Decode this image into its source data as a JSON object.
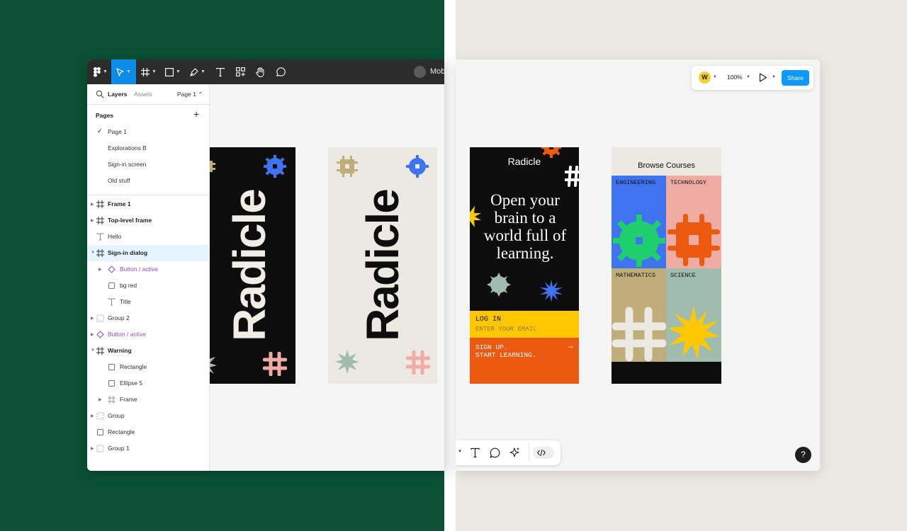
{
  "toolbar": {
    "file_name": "Mob"
  },
  "sidebar": {
    "tabs": {
      "layers": "Layers",
      "assets": "Assets"
    },
    "page_selector": "Page 1 ⌃",
    "pages_heading": "Pages",
    "pages_add": "+",
    "pages": [
      "Page 1",
      "Explorations B",
      "Sign-in screen",
      "Old stuff"
    ],
    "current_page_check": "✓",
    "layers": [
      {
        "label": "Frame 1"
      },
      {
        "label": "Top-level frame"
      },
      {
        "label": "Hello"
      },
      {
        "label": "Sign-in dialog"
      },
      {
        "label": "Button / active"
      },
      {
        "label": "bg red"
      },
      {
        "label": "Title"
      },
      {
        "label": "Group 2"
      },
      {
        "label": "Button / active"
      },
      {
        "label": "Warning"
      },
      {
        "label": "Rectangle"
      },
      {
        "label": "Ellipse 5"
      },
      {
        "label": "Frame"
      },
      {
        "label": "Group"
      },
      {
        "label": "Rectangle"
      },
      {
        "label": "Group 1"
      }
    ]
  },
  "topbar_right": {
    "avatar_initial": "W",
    "zoom": "100%",
    "share_label": "Share"
  },
  "help_label": "?",
  "frames": {
    "word": "Radicle",
    "signin": {
      "logo": "Radicle",
      "headline": "Open your brain to a world full of learning.",
      "login_label": "LOG IN",
      "email_placeholder": "ENTER YOUR EMAIL",
      "signup_line1": "SIGN UP.",
      "signup_line2": "START LEARNING.",
      "arrow": "→"
    },
    "courses": {
      "title": "Browse Courses",
      "categories": [
        "ENGINEERING",
        "TECHNOLOGY",
        "MATHEMATICS",
        "SCIENCE"
      ]
    }
  },
  "colors": {
    "bg_green": "#0b5136",
    "accent_blue": "#0c8ce9",
    "share_blue": "#0d99ff",
    "frame_black": "#0d0d0d",
    "frame_cream": "#ece8e2",
    "login_yellow": "#ffc800",
    "signup_orange": "#ec5a12",
    "cell_blue": "#3f73f0",
    "cell_pink": "#f0aca2",
    "cell_tan": "#c1ac7c",
    "cell_sage": "#9fbcae"
  },
  "icons": [
    "figma-menu-icon",
    "move-tool-icon",
    "frame-tool-icon",
    "rectangle-tool-icon",
    "pen-tool-icon",
    "text-tool-icon",
    "components-icon",
    "hand-tool-icon",
    "comment-icon",
    "search-icon",
    "play-icon",
    "actions-icon",
    "code-icon"
  ]
}
